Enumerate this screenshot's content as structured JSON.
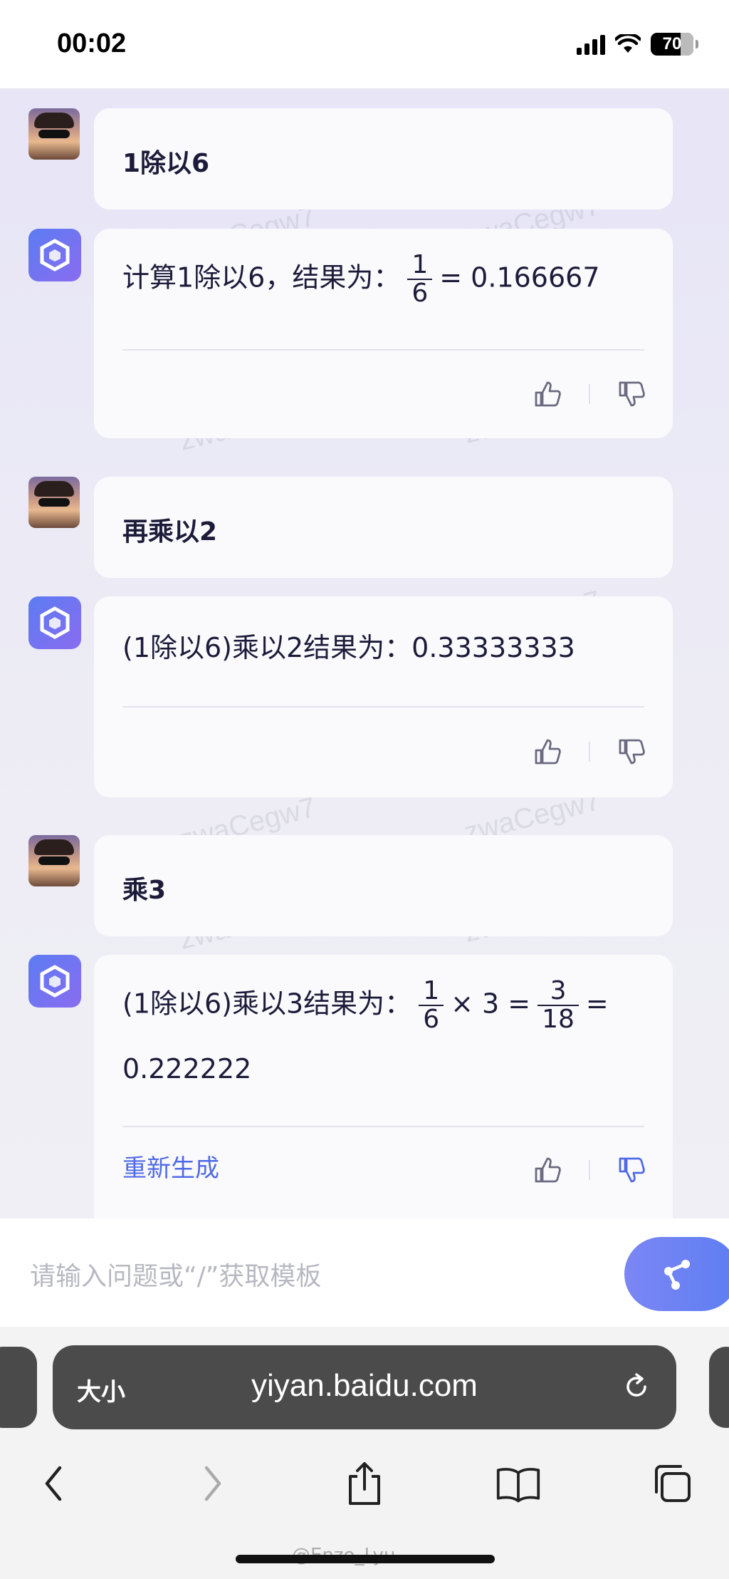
{
  "status_bar": {
    "time": "00:02",
    "battery": "70"
  },
  "watermark": "zwaCegw7",
  "conversation": [
    {
      "role": "user",
      "text": "1除以6"
    },
    {
      "role": "bot",
      "prefix": "计算1除以6，结果为：",
      "frac_num": "1",
      "frac_den": "6",
      "suffix": "= 0.166667"
    },
    {
      "role": "user",
      "text": "再乘以2"
    },
    {
      "role": "bot",
      "text": "(1除以6)乘以2结果为：0.33333333"
    },
    {
      "role": "user",
      "text": "乘3"
    },
    {
      "role": "bot",
      "prefix": "(1除以6)乘以3结果为：",
      "frac1_num": "1",
      "frac1_den": "6",
      "times": "× 3 =",
      "frac2_num": "3",
      "frac2_den": "18",
      "eq": "=",
      "line2": "0.222222",
      "regenerate": "重新生成"
    }
  ],
  "input": {
    "placeholder": "请输入问题或“/”获取模板"
  },
  "browser": {
    "aa": "大小",
    "url": "yiyan.baidu.com"
  },
  "credit": "@Enzo_Lyu",
  "icons": {
    "like": "thumbs-up-icon",
    "dislike": "thumbs-down-icon",
    "send": "send-icon",
    "reload": "reload-icon"
  }
}
